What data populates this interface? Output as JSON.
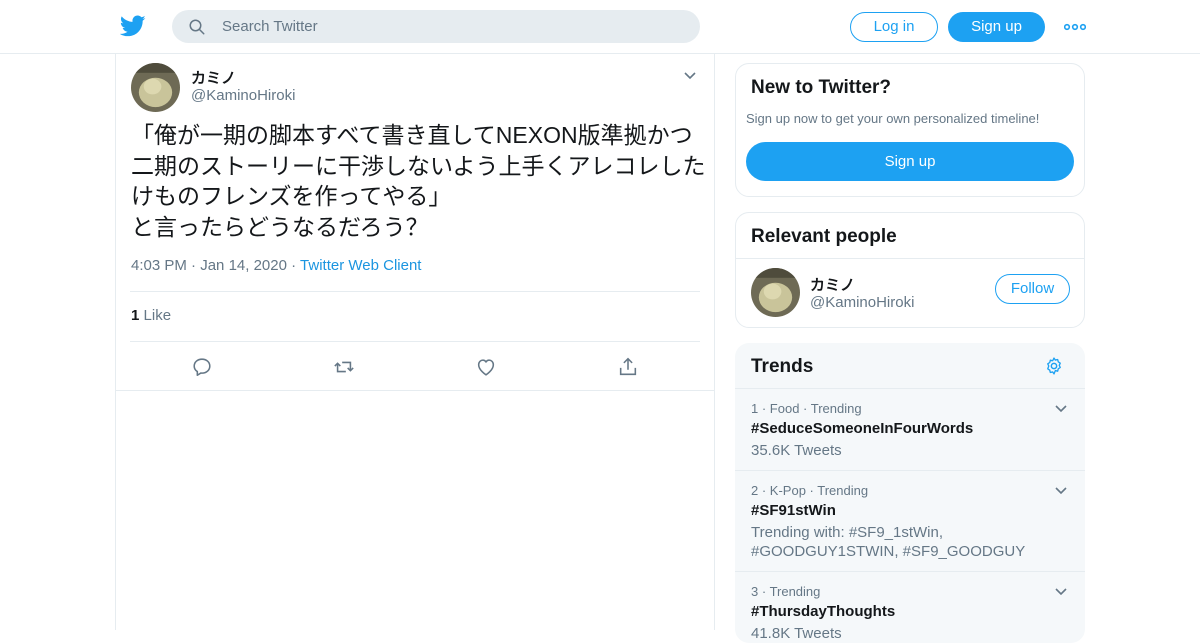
{
  "header": {
    "search_placeholder": "Search Twitter",
    "login_label": "Log in",
    "signup_label": "Sign up",
    "brand_color": "#1da1f2"
  },
  "tweet": {
    "display_name": "カミノ",
    "handle": "@KaminoHiroki",
    "text": "「俺が一期の脚本すべて書き直してNEXON版準拠かつ二期のストーリーに干渉しないよう上手くアレコレしたけものフレンズを作ってやる」\nと言ったらどうなるだろう？",
    "time": "4:03 PM",
    "date": "Jan 14, 2020",
    "client": "Twitter Web Client",
    "like_count": "1",
    "like_label": "Like",
    "actions": [
      "reply-icon",
      "retweet-icon",
      "like-icon",
      "share-icon"
    ]
  },
  "new_to_twitter": {
    "title": "New to Twitter?",
    "description": "Sign up now to get your own personalized timeline!",
    "signup_label": "Sign up"
  },
  "relevant_people": {
    "title": "Relevant people",
    "display_name": "カミノ",
    "handle": "@KaminoHiroki",
    "follow_label": "Follow"
  },
  "trends": {
    "title": "Trends",
    "items": [
      {
        "rank": "1",
        "category": "Food",
        "status": "Trending",
        "name": "#SeduceSomeoneInFourWords",
        "detail": "35.6K Tweets"
      },
      {
        "rank": "2",
        "category": "K-Pop",
        "status": "Trending",
        "name": "#SF91stWin",
        "detail": "Trending with: #SF9_1stWin, #GOODGUY1STWIN, #SF9_GOODGUY"
      },
      {
        "rank": "3",
        "category": "",
        "status": "Trending",
        "name": "#ThursdayThoughts",
        "detail": "41.8K Tweets"
      }
    ]
  }
}
